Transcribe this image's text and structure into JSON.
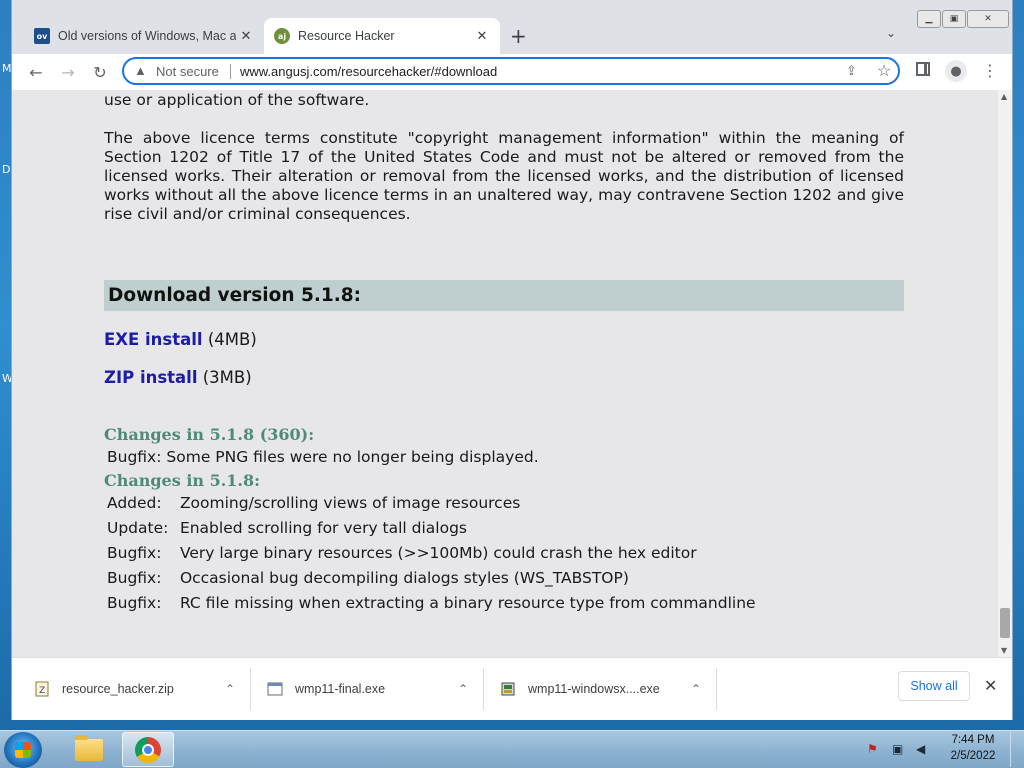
{
  "browser": {
    "tabs": [
      {
        "title": "Old versions of Windows, Mac and",
        "favicon": "ov",
        "active": false
      },
      {
        "title": "Resource Hacker",
        "favicon": "aj",
        "active": true
      }
    ],
    "address": {
      "security_label": "Not secure",
      "url": "www.angusj.com/resourcehacker/#download"
    }
  },
  "page": {
    "top_line": "use or application of the software.",
    "licence_paragraph": "The above licence terms constitute \"copyright management information\" within the meaning of Section 1202 of Title 17 of the United States Code and must not be altered or removed from the licensed works. Their alteration or removal from the licensed works, and the distribution of licensed works without all the above licence terms in an unaltered way, may contravene Section 1202 and give rise civil and/or criminal consequences.",
    "download_heading": "Download version 5.1.8:",
    "downloads": [
      {
        "label": "EXE install",
        "size": "(4MB)"
      },
      {
        "label": "ZIP install",
        "size": "(3MB)"
      }
    ],
    "changes": [
      {
        "heading": "Changes in 5.1.8 (360):",
        "items": [
          {
            "kind": "Bugfix:",
            "text": "Some PNG files were no longer being displayed."
          }
        ]
      },
      {
        "heading": "Changes in 5.1.8:",
        "items": [
          {
            "kind": "Added:",
            "text": "Zooming/scrolling views of image resources"
          },
          {
            "kind": "Update:",
            "text": "Enabled scrolling for very tall dialogs"
          },
          {
            "kind": "Bugfix:",
            "text": "Very large binary resources (>>100Mb) could crash the hex editor"
          },
          {
            "kind": "Bugfix:",
            "text": "Occasional bug decompiling dialogs styles (WS_TABSTOP)"
          },
          {
            "kind": "Bugfix:",
            "text": "RC file missing when extracting a binary resource type from commandline"
          }
        ]
      }
    ]
  },
  "download_shelf": {
    "items": [
      {
        "name": "resource_hacker.zip",
        "icon": "zip-file-icon"
      },
      {
        "name": "wmp11-final.exe",
        "icon": "exe-file-icon"
      },
      {
        "name": "wmp11-windowsx....exe",
        "icon": "installer-file-icon"
      }
    ],
    "show_all": "Show all"
  },
  "taskbar": {
    "time": "7:44 PM",
    "date": "2/5/2022"
  },
  "colors": {
    "link": "#1c1ca6",
    "changes_heading": "#4f8a72",
    "download_bar": "#bfcfcf",
    "page_bg": "#e7e7ea",
    "omnibox_focus": "#1a73e8"
  }
}
